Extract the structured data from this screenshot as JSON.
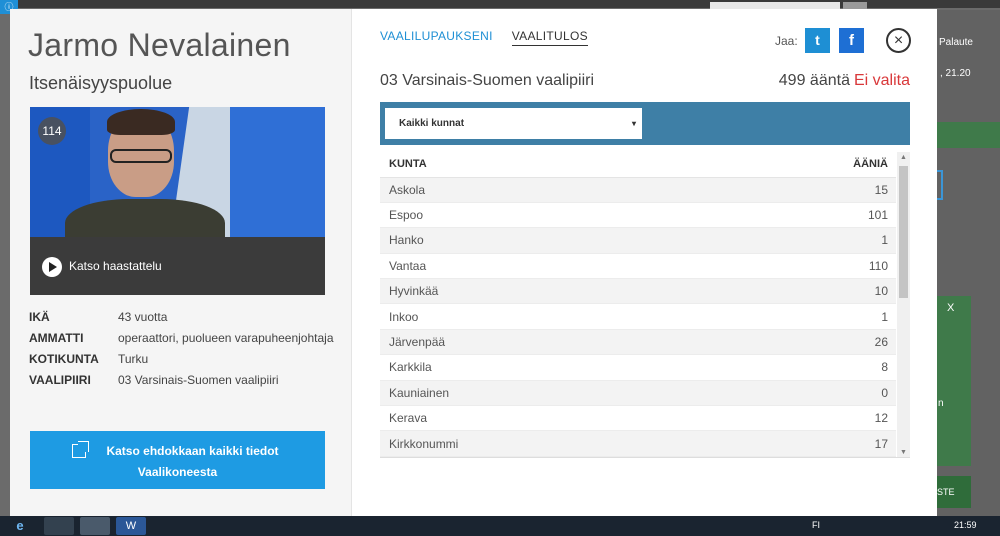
{
  "background": {
    "feedback_label": "Palaute",
    "time_text": ", 21.20",
    "close_x": "X",
    "partial_n": "n",
    "partial_ste": "STE"
  },
  "candidate": {
    "name": "Jarmo Nevalainen",
    "party": "Itsenäisyyspuolue",
    "number": "114",
    "watch_label": "Katso haastattelu",
    "info": [
      {
        "key": "IKÄ",
        "value": "43 vuotta"
      },
      {
        "key": "AMMATTI",
        "value": "operaattori, puolueen varapuheenjohtaja"
      },
      {
        "key": "KOTIKUNTA",
        "value": "Turku"
      },
      {
        "key": "VAALIPIIRI",
        "value": "03 Varsinais-Suomen vaalipiiri"
      }
    ],
    "cta_line1": "Katso ehdokkaan kaikki tiedot",
    "cta_line2": "Vaalikoneesta"
  },
  "tabs": [
    {
      "label": "VAALILUPAUKSENI",
      "active": false
    },
    {
      "label": "VAALITULOS",
      "active": true
    }
  ],
  "share": {
    "label": "Jaa:",
    "twitter_glyph": "t",
    "facebook_glyph": "f",
    "close_glyph": "×"
  },
  "result": {
    "district": "03 Varsinais-Suomen vaalipiiri",
    "votes": "499 ääntä",
    "status": "Ei valita",
    "status_color": "#d9383a"
  },
  "filter": {
    "selected": "Kaikki kunnat",
    "caret": "▾"
  },
  "table": {
    "headers": [
      "KUNTA",
      "ÄÄNIÄ"
    ],
    "rows": [
      {
        "kunta": "Askola",
        "aania": "15"
      },
      {
        "kunta": "Espoo",
        "aania": "101"
      },
      {
        "kunta": "Hanko",
        "aania": "1"
      },
      {
        "kunta": "Vantaa",
        "aania": "110"
      },
      {
        "kunta": "Hyvinkää",
        "aania": "10"
      },
      {
        "kunta": "Inkoo",
        "aania": "1"
      },
      {
        "kunta": "Järvenpää",
        "aania": "26"
      },
      {
        "kunta": "Karkkila",
        "aania": "8"
      },
      {
        "kunta": "Kauniainen",
        "aania": "0"
      },
      {
        "kunta": "Kerava",
        "aania": "12"
      },
      {
        "kunta": "Kirkkonummi",
        "aania": "17"
      }
    ]
  },
  "taskbar": {
    "start_glyph": "e",
    "apps": [
      "",
      "",
      "W"
    ],
    "tray_text": "FI",
    "clock": "21:59"
  },
  "colors": {
    "accent": "#1e9be3",
    "tab_link": "#1e8fd4",
    "filter_bar": "#3e7fa6",
    "status_red": "#d9383a"
  }
}
